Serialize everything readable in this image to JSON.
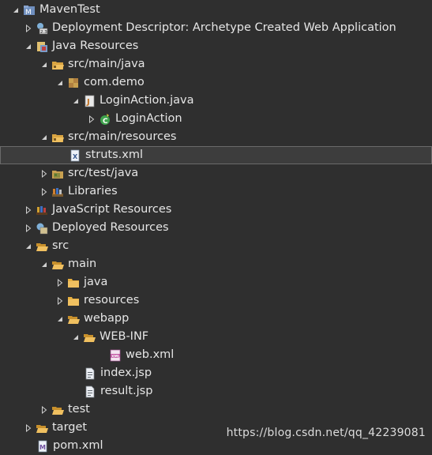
{
  "tree": [
    {
      "label": "MavenTest",
      "icon": "project-icon",
      "expanded": true
    },
    {
      "label": "Deployment Descriptor: Archetype Created Web Application",
      "icon": "deployment-descriptor-icon",
      "expanded": false
    },
    {
      "label": "Java Resources",
      "icon": "java-resources-icon",
      "expanded": true
    },
    {
      "label": "src/main/java",
      "icon": "source-folder-icon",
      "expanded": true
    },
    {
      "label": "com.demo",
      "icon": "package-icon",
      "expanded": true
    },
    {
      "label": "LoginAction.java",
      "icon": "java-file-icon",
      "expanded": true
    },
    {
      "label": "LoginAction",
      "icon": "class-icon",
      "expanded": false
    },
    {
      "label": "src/main/resources",
      "icon": "source-folder-icon",
      "expanded": true
    },
    {
      "label": "struts.xml",
      "icon": "xml-file-icon",
      "expanded": null,
      "selected": true
    },
    {
      "label": "src/test/java",
      "icon": "source-folder-icon",
      "expanded": false
    },
    {
      "label": "Libraries",
      "icon": "libraries-icon",
      "expanded": false
    },
    {
      "label": "JavaScript Resources",
      "icon": "javascript-resources-icon",
      "expanded": false
    },
    {
      "label": "Deployed Resources",
      "icon": "deployed-resources-icon",
      "expanded": false
    },
    {
      "label": "src",
      "icon": "folder-open-icon",
      "expanded": true
    },
    {
      "label": "main",
      "icon": "folder-open-icon",
      "expanded": true
    },
    {
      "label": "java",
      "icon": "folder-icon",
      "expanded": false
    },
    {
      "label": "resources",
      "icon": "folder-icon",
      "expanded": false
    },
    {
      "label": "webapp",
      "icon": "folder-open-icon",
      "expanded": true
    },
    {
      "label": "WEB-INF",
      "icon": "folder-open-icon",
      "expanded": true
    },
    {
      "label": "web.xml",
      "icon": "web-xml-icon",
      "expanded": null
    },
    {
      "label": "index.jsp",
      "icon": "jsp-file-icon",
      "expanded": null
    },
    {
      "label": "result.jsp",
      "icon": "jsp-file-icon",
      "expanded": null
    },
    {
      "label": "test",
      "icon": "folder-icon",
      "expanded": false
    },
    {
      "label": "target",
      "icon": "folder-icon",
      "expanded": false
    },
    {
      "label": "pom.xml",
      "icon": "pom-xml-icon",
      "expanded": null
    }
  ],
  "watermark": "https://blog.csdn.net/qq_42239081",
  "colors": {
    "background": "#2f2f2f",
    "text": "#e6e6e6",
    "selection": "#3d3d3d",
    "selection_border": "#6a6a6a"
  }
}
